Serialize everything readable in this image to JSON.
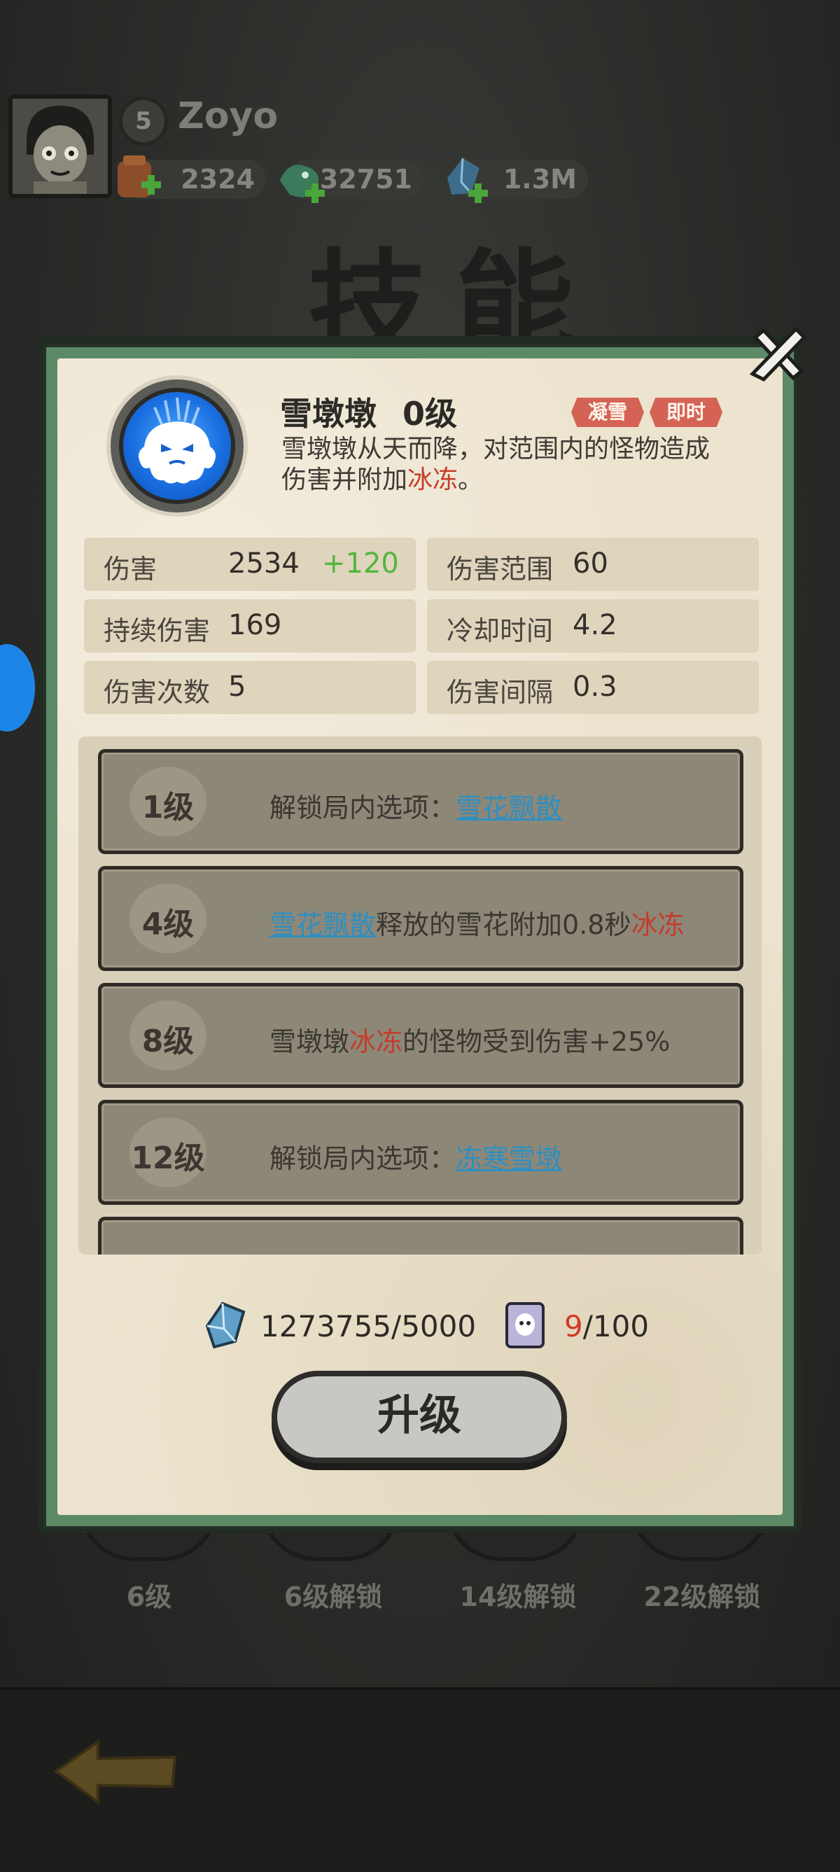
{
  "header": {
    "player_level": "5",
    "player_name": "Zoyo",
    "currencies": [
      {
        "icon": "food-bag-icon",
        "value": "2324"
      },
      {
        "icon": "dragon-icon",
        "value": "32751"
      },
      {
        "icon": "crystal-icon",
        "value": "1.3M"
      }
    ],
    "page_title": "技能"
  },
  "background_skills": [
    {
      "label": "6级"
    },
    {
      "label": "6级解锁"
    },
    {
      "label": "14级解锁"
    },
    {
      "label": "22级解锁"
    }
  ],
  "skill": {
    "icon": "snow-ghost-icon",
    "name": "雪墩墩",
    "level": "0级",
    "tags": [
      "凝雪",
      "即时"
    ],
    "description_prefix": "雪墩墩从天而降，对范围内的怪物造成伤害并附加",
    "description_highlight": "冰冻",
    "description_suffix": "。"
  },
  "stats": [
    {
      "label": "伤害",
      "value": "2534",
      "bonus": "+120"
    },
    {
      "label": "伤害范围",
      "value": "60"
    },
    {
      "label": "持续伤害",
      "value": "169"
    },
    {
      "label": "冷却时间",
      "value": "4.2"
    },
    {
      "label": "伤害次数",
      "value": "5"
    },
    {
      "label": "伤害间隔",
      "value": "0.3"
    }
  ],
  "unlocks": [
    {
      "level": "1级",
      "pre": "解锁局内选项：",
      "link": "雪花飘散"
    },
    {
      "level": "4级",
      "link": "雪花飘散",
      "mid": "释放的雪花附加0.8秒",
      "hl": "冰冻"
    },
    {
      "level": "8级",
      "pre": "雪墩墩",
      "hl": "冰冻",
      "post": "的怪物受到伤害+25%"
    },
    {
      "level": "12级",
      "pre": "解锁局内选项：",
      "link": "冻寒雪墩"
    }
  ],
  "cost": {
    "crystal_icon": "crystal-icon",
    "crystal_text": "1273755/5000",
    "card_icon": "skill-card-icon",
    "card_have": "9",
    "card_need": "/100"
  },
  "upgrade_label": "升级",
  "colors": {
    "accent_red": "#c53c2a",
    "link_blue": "#2f8fc0",
    "bonus_green": "#51b63e",
    "frame_green": "#5c8a67",
    "tag_red": "#d46356"
  }
}
